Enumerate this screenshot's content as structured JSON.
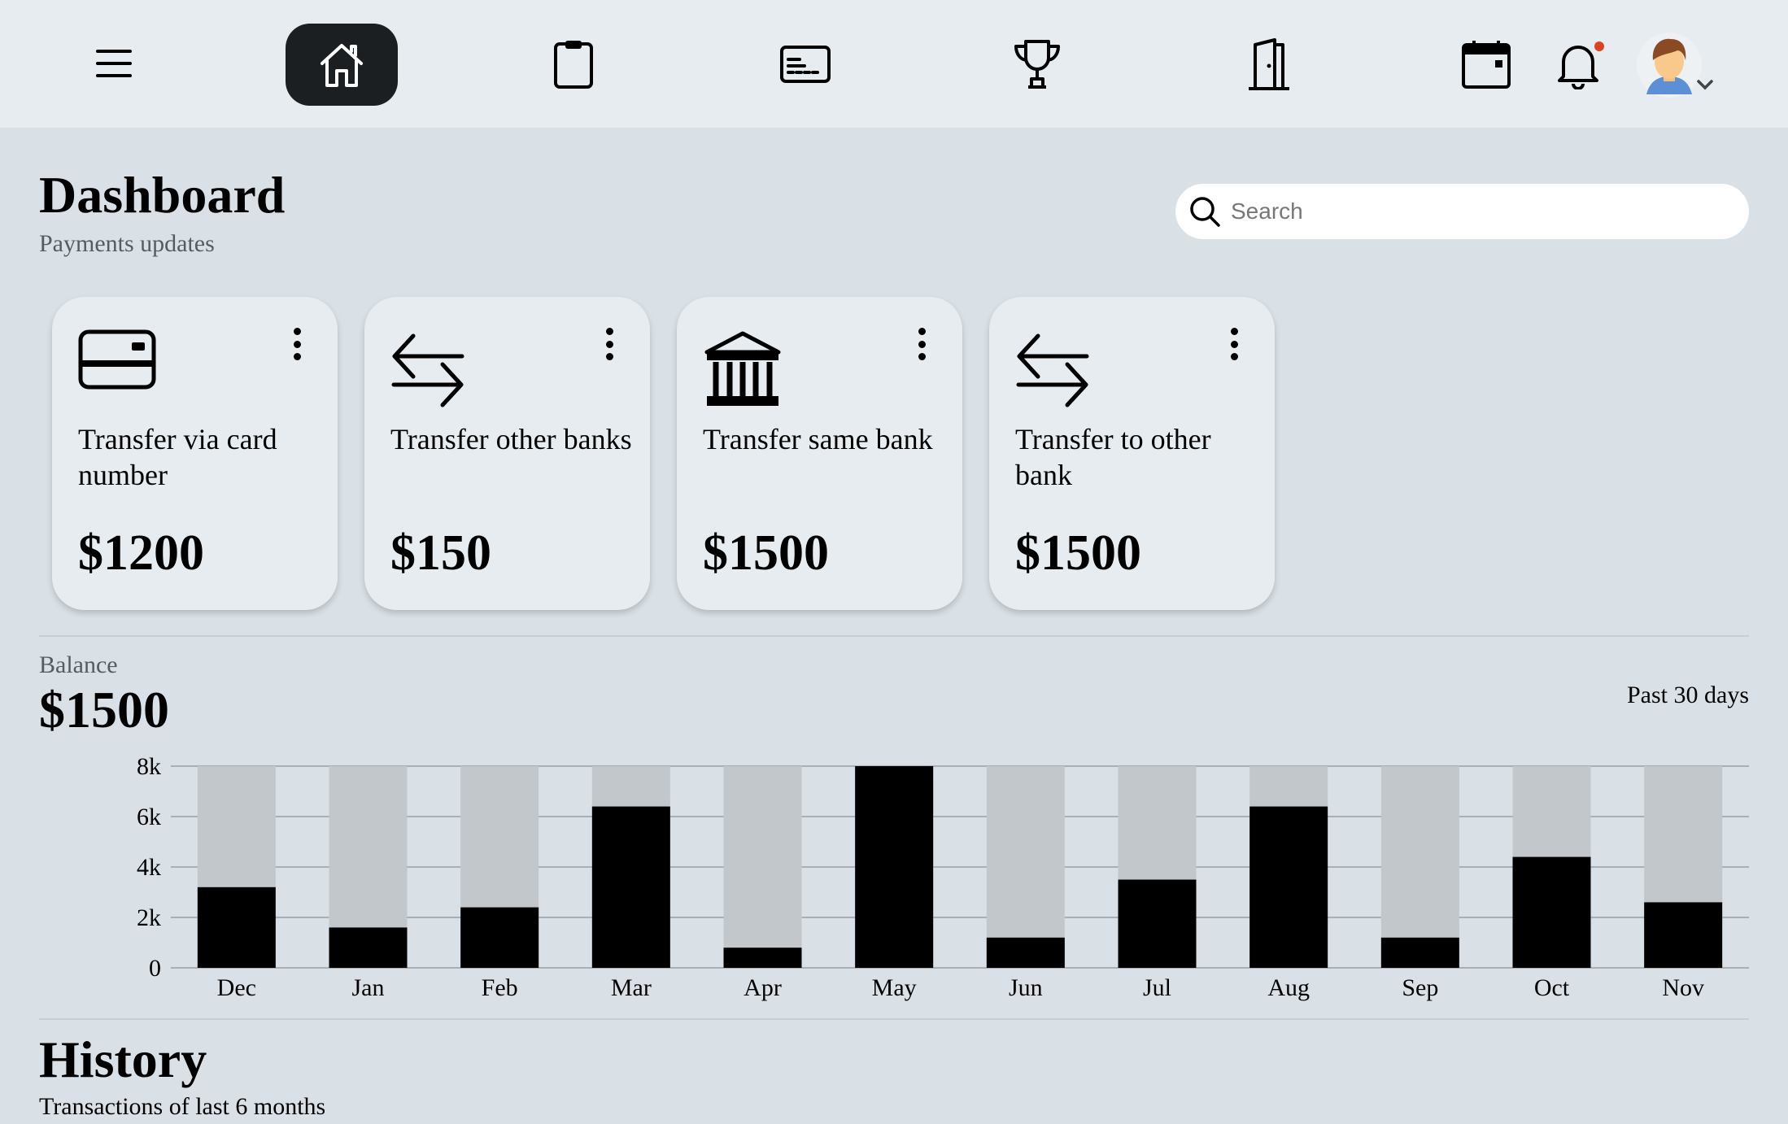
{
  "nav": {
    "items": [
      "menu-icon",
      "home-icon",
      "clipboard-icon",
      "card-icon",
      "trophy-icon",
      "door-icon",
      "calendar-icon",
      "bell-icon",
      "avatar"
    ]
  },
  "header": {
    "title": "Dashboard",
    "subtitle": "Payments updates"
  },
  "search": {
    "placeholder": "Search"
  },
  "cards": [
    {
      "icon": "credit-card-icon",
      "label": "Transfer via card number",
      "amount": "$1200"
    },
    {
      "icon": "transfer-arrows-icon",
      "label": "Transfer other banks",
      "amount": "$150"
    },
    {
      "icon": "bank-icon",
      "label": "Transfer same bank",
      "amount": "$1500"
    },
    {
      "icon": "transfer-arrows-icon",
      "label": "Transfer to other bank",
      "amount": "$1500"
    }
  ],
  "balance": {
    "label": "Balance",
    "amount": "$1500",
    "period": "Past 30 days"
  },
  "chart_data": {
    "type": "bar",
    "stacked_background": true,
    "categories": [
      "Dec",
      "Jan",
      "Feb",
      "Mar",
      "Apr",
      "May",
      "Jun",
      "Jul",
      "Aug",
      "Sep",
      "Oct",
      "Nov"
    ],
    "values": [
      3200,
      1600,
      2400,
      6400,
      800,
      8000,
      1200,
      3500,
      6400,
      1200,
      4400,
      2600
    ],
    "max_values": [
      8000,
      8000,
      8000,
      8000,
      8000,
      8000,
      8000,
      8000,
      8000,
      8000,
      8000,
      8000
    ],
    "yticks": [
      "0",
      "2k",
      "4k",
      "6k",
      "8k"
    ],
    "ylim": [
      0,
      8000
    ],
    "grid": true,
    "colors": {
      "value": "#000000",
      "remainder": "#c1c7cb",
      "grid": "#a9b0b5"
    }
  },
  "history": {
    "title": "History",
    "subtitle": "Transactions of last 6 months"
  }
}
